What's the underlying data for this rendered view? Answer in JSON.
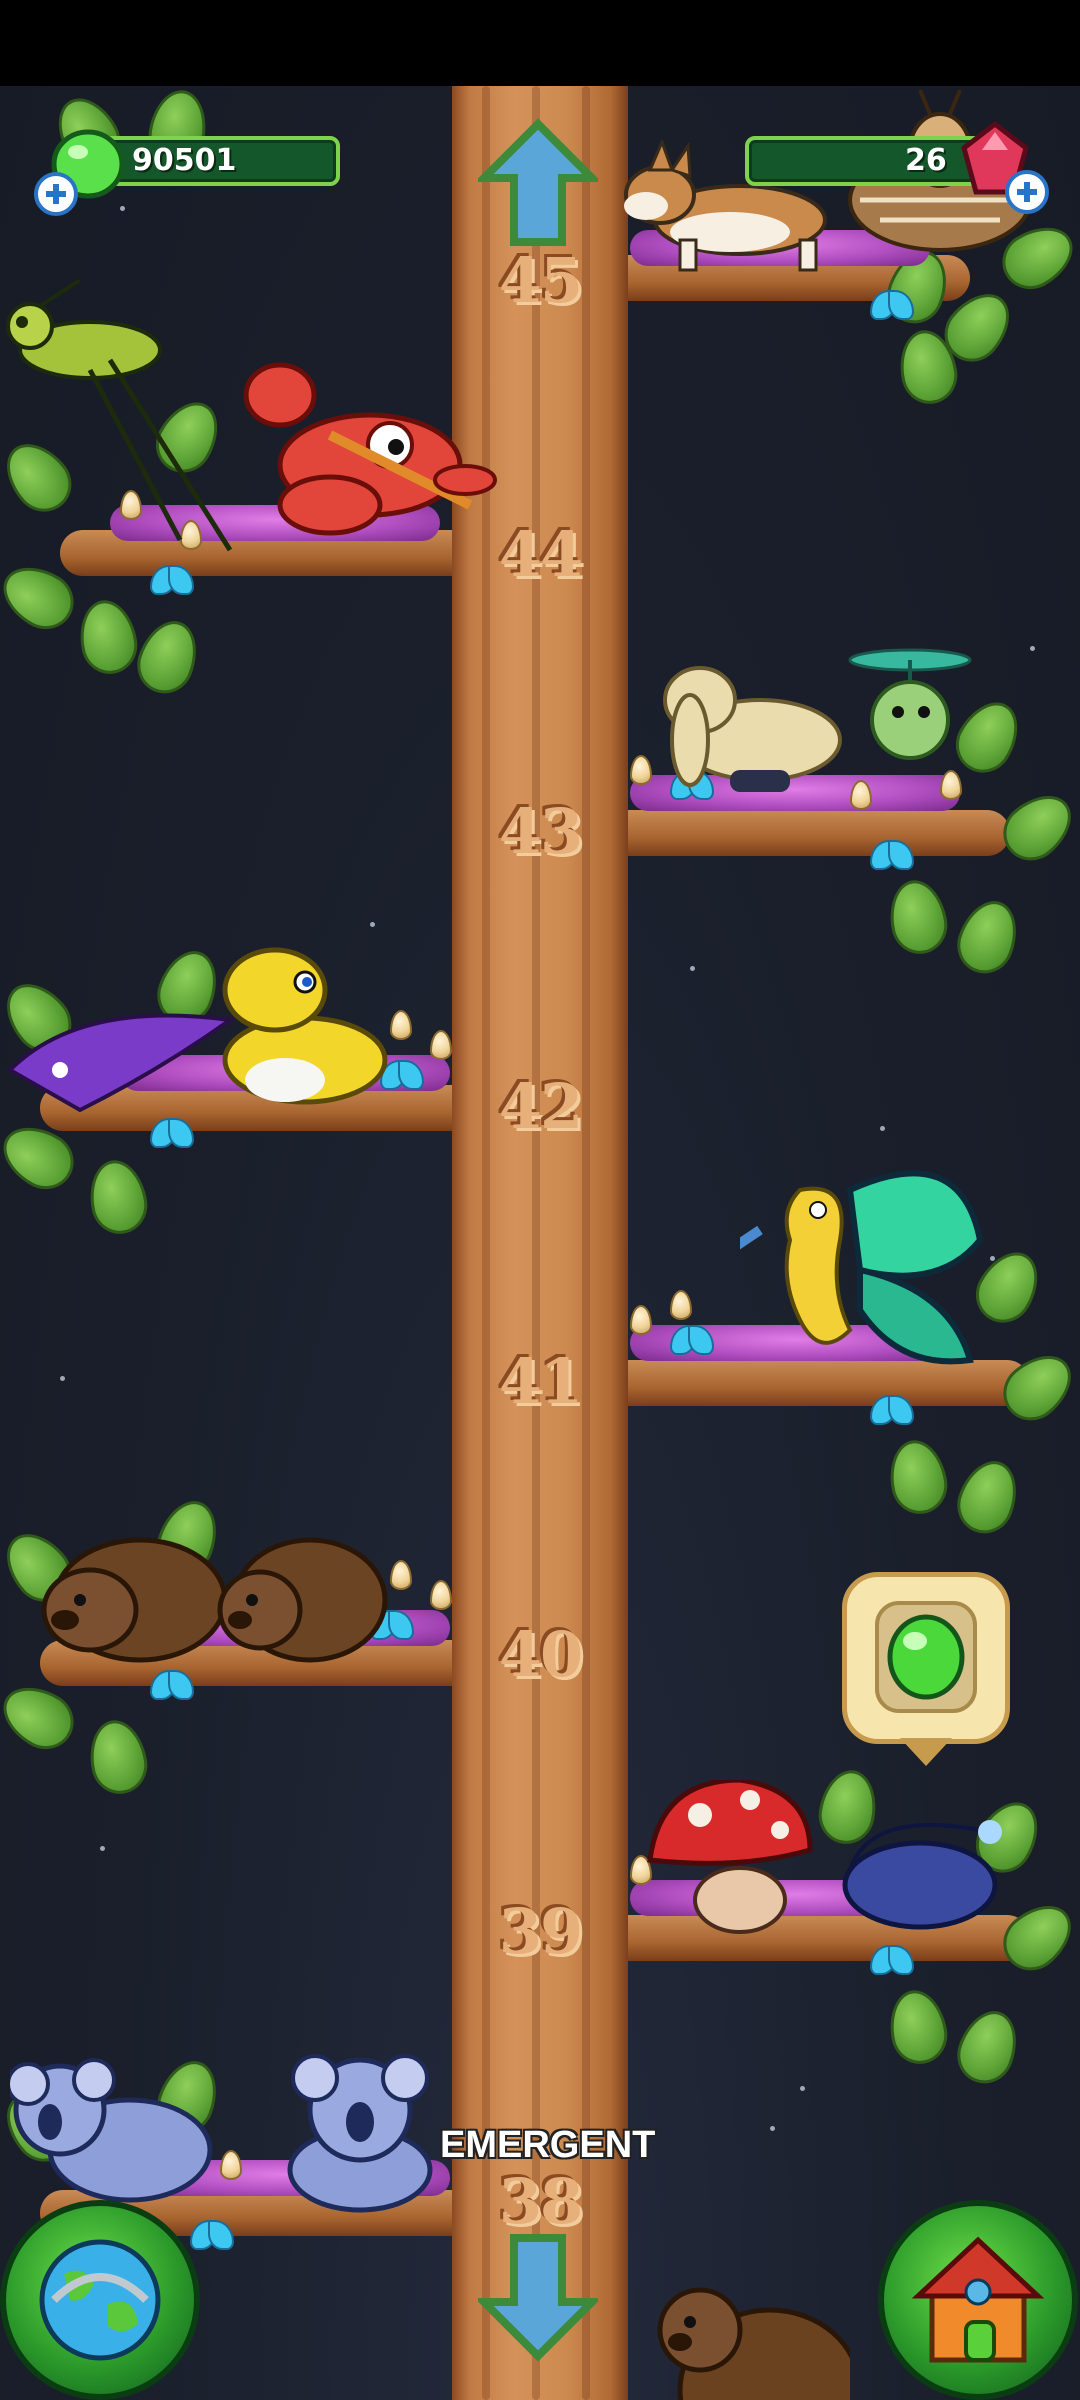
{
  "hud": {
    "slime_count": "90501",
    "gem_count": "26"
  },
  "tree": {
    "zone_label": "EMERGENT",
    "levels": [
      "45",
      "44",
      "43",
      "42",
      "41",
      "40",
      "39",
      "38"
    ]
  },
  "icons": {
    "currency": "green-slime-icon",
    "premium": "red-gem-icon",
    "add": "plus-icon",
    "up": "up-arrow-icon",
    "down": "down-arrow-icon",
    "map": "globe-icon",
    "home": "house-icon",
    "collect": "slime-bubble-icon"
  },
  "animals": [
    "corgi",
    "tiger-moth",
    "grasshopper",
    "lobster",
    "rabbit",
    "helicopter-seed",
    "manta-ray",
    "yellow-snake",
    "seahorse",
    "butterfly",
    "wombat",
    "wombat",
    "mushroom-creature",
    "anglerfish",
    "koala",
    "koala",
    "bear"
  ],
  "colors": {
    "sky": "#1a1f2b",
    "trunk": "#cd8a50",
    "leaf": "#5ca336",
    "hud_bar": "#14572a",
    "hud_border": "#7fd24b",
    "accent_blue": "#2a74c8"
  }
}
